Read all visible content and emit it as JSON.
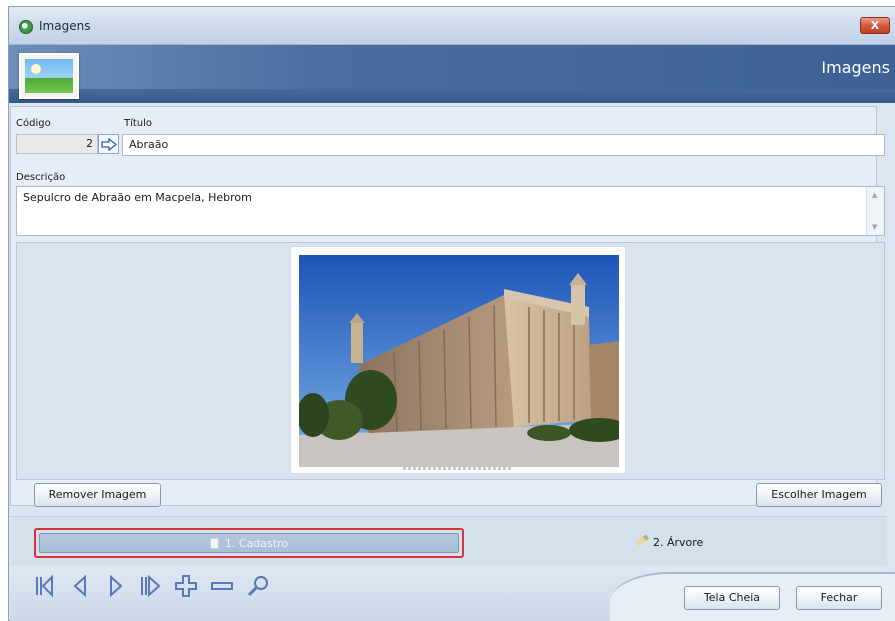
{
  "window": {
    "title": "Imagens",
    "close_label": "X"
  },
  "banner": {
    "title": "Imagens"
  },
  "form": {
    "codigo_label": "Código",
    "codigo_value": "2",
    "titulo_label": "Título",
    "titulo_value": "Abraão",
    "descricao_label": "Descrição",
    "descricao_value": "Sepulcro de Abraão em Macpela, Hebrom"
  },
  "image_buttons": {
    "remove": "Remover Imagem",
    "choose": "Escolher Imagem"
  },
  "tabs": [
    {
      "label": "1. Cadastro",
      "active": true
    },
    {
      "label": "2. Árvore",
      "active": false
    }
  ],
  "nav": {
    "icons": [
      "first-record-icon",
      "previous-record-icon",
      "next-record-icon",
      "last-record-icon",
      "add-record-icon",
      "delete-record-icon",
      "search-icon"
    ],
    "color": "#5a79b8"
  },
  "actions": {
    "fullscreen": "Tela Cheia",
    "close": "Fechar"
  },
  "colors": {
    "banner": "#4a6f9f",
    "highlight": "#d6343a"
  }
}
